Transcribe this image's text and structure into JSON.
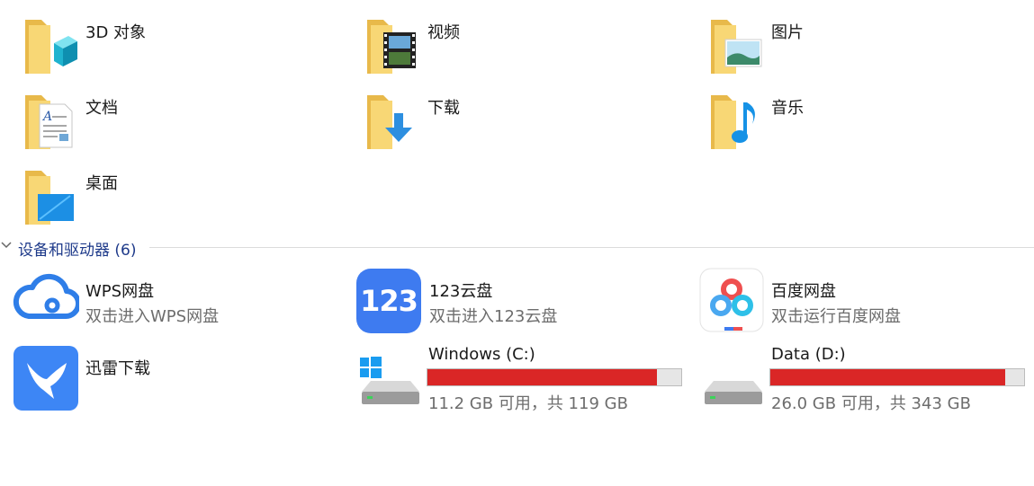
{
  "folders": [
    {
      "label": "3D 对象",
      "icon": "3d-objects-icon"
    },
    {
      "label": "视频",
      "icon": "videos-icon"
    },
    {
      "label": "图片",
      "icon": "pictures-icon"
    },
    {
      "label": "文档",
      "icon": "documents-icon"
    },
    {
      "label": "下载",
      "icon": "downloads-icon"
    },
    {
      "label": "音乐",
      "icon": "music-icon"
    },
    {
      "label": "桌面",
      "icon": "desktop-icon"
    }
  ],
  "devices_section": {
    "title": "设备和驱动器 (6)"
  },
  "devices": [
    {
      "name": "WPS网盘",
      "subtitle": "双击进入WPS网盘",
      "icon": "wps-cloud-icon"
    },
    {
      "name": "123云盘",
      "subtitle": "双击进入123云盘",
      "icon": "123-cloud-icon",
      "icon_text": "123"
    },
    {
      "name": "百度网盘",
      "subtitle": "双击运行百度网盘",
      "icon": "baidu-netdisk-icon"
    },
    {
      "name": "迅雷下载",
      "icon": "xunlei-icon"
    }
  ],
  "drives": [
    {
      "name": "Windows (C:)",
      "info": "11.2 GB 可用，共 119 GB",
      "used_fraction": 0.906,
      "icon": "windows-drive-icon"
    },
    {
      "name": "Data (D:)",
      "info": "26.0 GB 可用，共 343 GB",
      "used_fraction": 0.924,
      "icon": "hard-drive-icon"
    }
  ],
  "colors": {
    "bar_fill": "#da2626",
    "accent_blue": "#1e3a8a"
  }
}
